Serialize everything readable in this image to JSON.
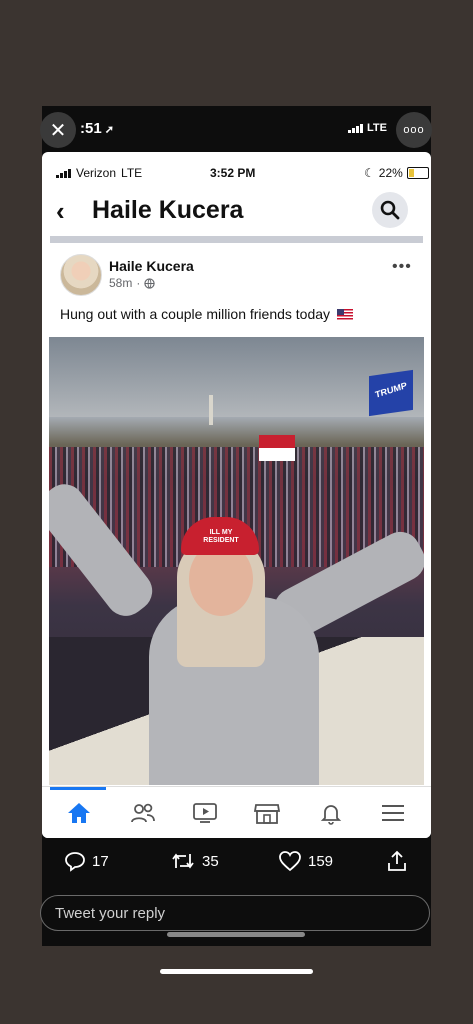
{
  "outer_status": {
    "time": ":51",
    "network": "LTE"
  },
  "fb_status": {
    "carrier": "Verizon",
    "network": "LTE",
    "time": "3:52 PM",
    "battery": "22%"
  },
  "header": {
    "back_glyph": "‹",
    "title": "Haile Kucera"
  },
  "post": {
    "author": "Haile Kucera",
    "age": "58m",
    "text": "Hung out with a couple million friends today",
    "more_glyph": "•••"
  },
  "photo_text": {
    "beanie": "ILL MY RESIDENT",
    "flag": "TRUMP"
  },
  "tabs": [
    "home-icon",
    "friends-icon",
    "watch-icon",
    "marketplace-icon",
    "bell-icon",
    "menu-icon"
  ],
  "tweet": {
    "replies": "17",
    "retweets": "35",
    "likes": "159",
    "reply_placeholder": "Tweet your reply"
  },
  "colors": {
    "fb_blue": "#1877f2",
    "background": "#3b3430"
  }
}
